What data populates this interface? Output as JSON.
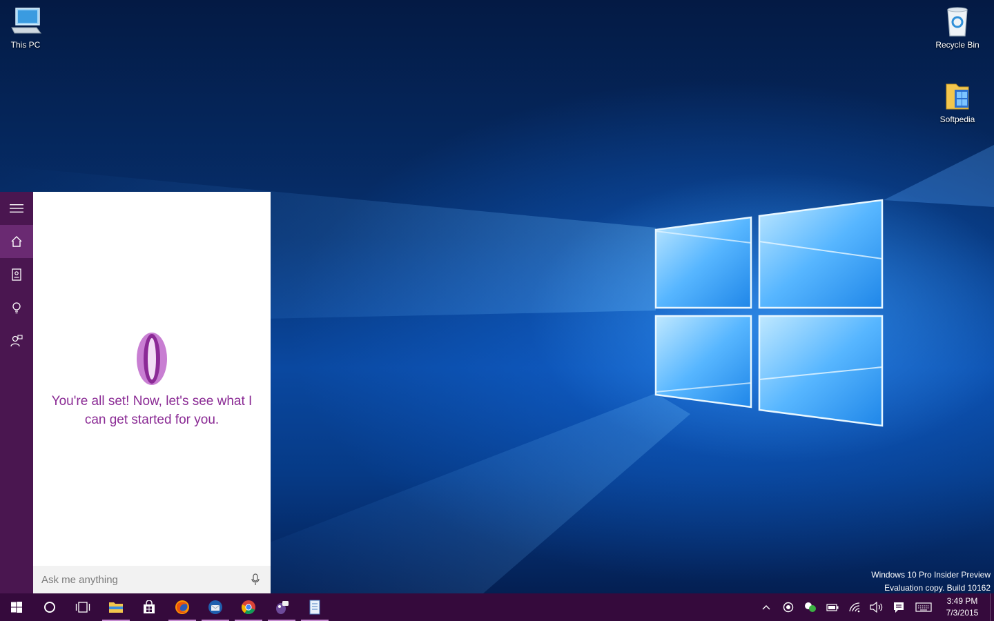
{
  "desktop": {
    "icons": [
      {
        "label": "This PC"
      },
      {
        "label": "Recycle Bin"
      },
      {
        "label": "Softpedia"
      }
    ]
  },
  "cortana": {
    "message": "You're all set! Now, let's see what I can get started for you.",
    "search": {
      "placeholder": "Ask me anything",
      "value": ""
    },
    "rail_items": [
      "hamburger-menu-icon",
      "home-icon",
      "notebook-icon",
      "reminders-icon",
      "feedback-icon"
    ]
  },
  "watermark": {
    "line1": "Windows 10 Pro Insider Preview",
    "line2": "Evaluation copy. Build 10162"
  },
  "taskbar": {
    "apps": [
      "start-icon",
      "cortana-icon",
      "task-view-icon",
      "file-explorer-icon",
      "store-icon",
      "firefox-icon",
      "thunderbird-icon",
      "chrome-icon",
      "pidgin-icon",
      "notepad-icon"
    ],
    "clock": {
      "time": "3:49 PM",
      "date": "7/3/2015"
    }
  },
  "colors": {
    "taskbar": "#350a3c",
    "cortana_rail": "#4a1650",
    "cortana_accent": "#8a2a94"
  }
}
